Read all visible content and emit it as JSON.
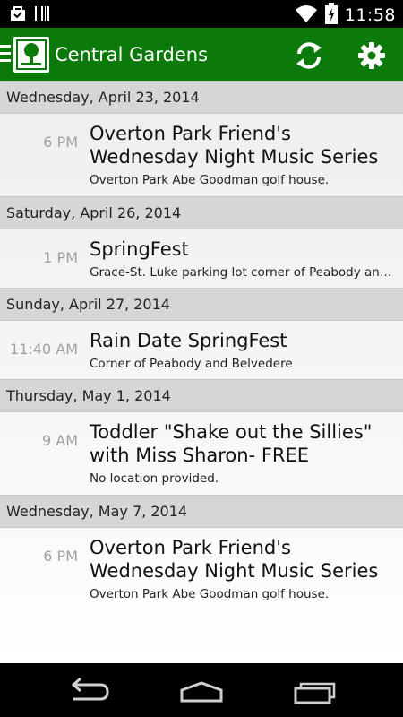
{
  "status_bar": {
    "time": "11:58",
    "icons": [
      "shopping-bag-icon",
      "barcode-icon",
      "wifi-icon",
      "battery-charging-icon"
    ]
  },
  "action_bar": {
    "title": "Central Gardens",
    "icons": [
      "menu-icon",
      "app-logo",
      "refresh-icon",
      "settings-icon"
    ],
    "color": "#0b7a0b"
  },
  "events": [
    {
      "date": "Wednesday, April 23, 2014",
      "time": "6 PM",
      "title": "Overton Park Friend's Wednesday Night Music Series",
      "location": "Overton Park Abe Goodman golf house."
    },
    {
      "date": "Saturday, April 26, 2014",
      "time": "1 PM",
      "title": "SpringFest",
      "location": "Grace-St. Luke parking lot corner of Peabody and..."
    },
    {
      "date": "Sunday, April 27, 2014",
      "time": "11:40 AM",
      "title": "Rain Date SpringFest",
      "location": "Corner of Peabody and Belvedere"
    },
    {
      "date": "Thursday, May 1, 2014",
      "time": "9 AM",
      "title": "Toddler \"Shake out the Sillies\" with Miss Sharon- FREE",
      "location": "No location provided."
    },
    {
      "date": "Wednesday, May 7, 2014",
      "time": "6 PM",
      "title": "Overton Park Friend's Wednesday Night Music Series",
      "location": "Overton Park Abe Goodman golf house."
    }
  ],
  "nav_bar": {
    "icons": [
      "back-icon",
      "home-icon",
      "recent-apps-icon"
    ]
  }
}
